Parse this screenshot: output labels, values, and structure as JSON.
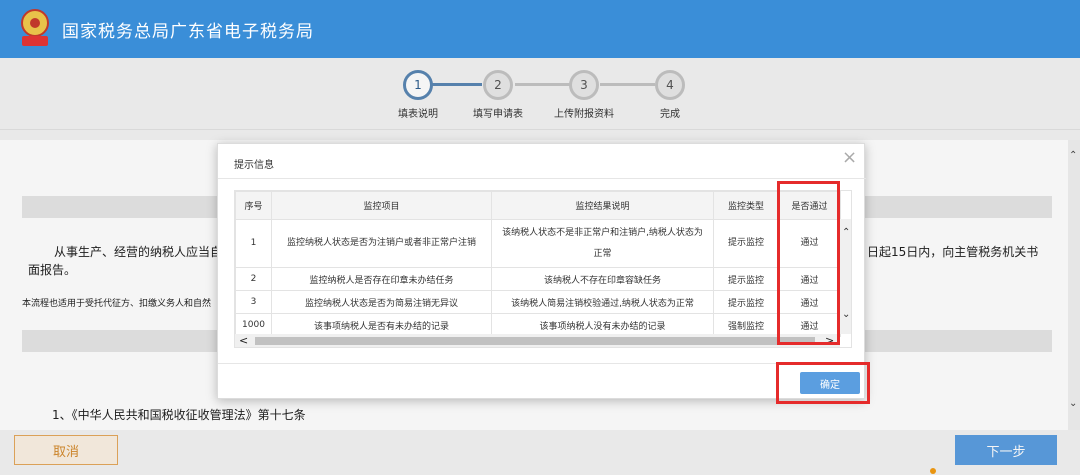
{
  "header": {
    "title": "国家税务总局广东省电子税务局"
  },
  "stepper": {
    "steps": [
      {
        "number": "1",
        "label": "填表说明"
      },
      {
        "number": "2",
        "label": "填写申请表"
      },
      {
        "number": "3",
        "label": "上传附报资料"
      },
      {
        "number": "4",
        "label": "完成"
      }
    ],
    "current_step": 1
  },
  "content": {
    "para1_left": "从事生产、经营的纳税人应当自",
    "para1_right": "日起15日内，向主管税务机关书",
    "para1_cont": "面报告。",
    "para2": "本流程也适用于受托代征方、扣缴义务人和自然",
    "law_item": "1、《中华人民共和国税收征收管理法》第十七条"
  },
  "dialog": {
    "title": "提示信息",
    "close_symbol": "×",
    "columns": [
      "序号",
      "监控项目",
      "监控结果说明",
      "监控类型",
      "是否通过"
    ],
    "rows": [
      {
        "no": "1",
        "item": "监控纳税人状态是否为注销户或者非正常户注销",
        "result_line1": "该纳税人状态不是非正常户和注销户,纳税人状态为",
        "result_line2": "正常",
        "type": "提示监控",
        "passed": "通过"
      },
      {
        "no": "2",
        "item": "监控纳税人是否存在印章未办结任务",
        "result_line1": "该纳税人不存在印章容缺任务",
        "result_line2": "",
        "type": "提示监控",
        "passed": "通过"
      },
      {
        "no": "3",
        "item": "监控纳税人状态是否为简易注销无异议",
        "result_line1": "该纳税人简易注销校验通过,纳税人状态为正常",
        "result_line2": "",
        "type": "提示监控",
        "passed": "通过"
      },
      {
        "no": "1000",
        "item": "该事项纳税人是否有未办结的记录",
        "result_line1": "该事项纳税人没有未办结的记录",
        "result_line2": "",
        "type": "强制监控",
        "passed": "通过"
      }
    ],
    "ok_label": "确定"
  },
  "footer": {
    "cancel_label": "取消",
    "next_label": "下一步"
  },
  "colors": {
    "header_bg": "#3a8ed8",
    "primary_button": "#5b9ee0",
    "highlight": "#e52b2b",
    "cancel_border": "#e4a85c"
  }
}
